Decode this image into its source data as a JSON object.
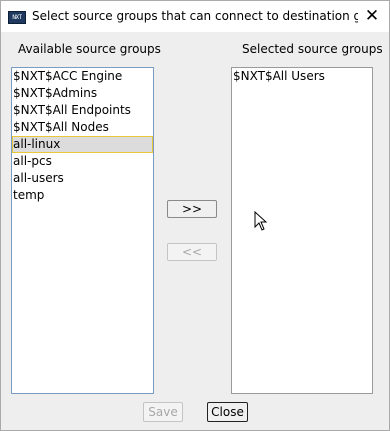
{
  "window": {
    "title": "Select source groups that can connect to destination group ...",
    "app_icon_text": "NXT"
  },
  "left_panel": {
    "label": "Available source groups",
    "items": [
      "$NXT$ACC Engine",
      "$NXT$Admins",
      "$NXT$All Endpoints",
      "$NXT$All Nodes",
      "all-linux",
      "all-pcs",
      "all-users",
      "temp"
    ],
    "selected": "all-linux"
  },
  "right_panel": {
    "label": "Selected source groups",
    "items": [
      "$NXT$All Users"
    ]
  },
  "buttons": {
    "add": ">>",
    "remove": "<<",
    "save": "Save",
    "close": "Close"
  },
  "icons": {
    "app": "nexthink-app-icon",
    "close": "close-icon",
    "cursor": "mouse-pointer-icon"
  }
}
